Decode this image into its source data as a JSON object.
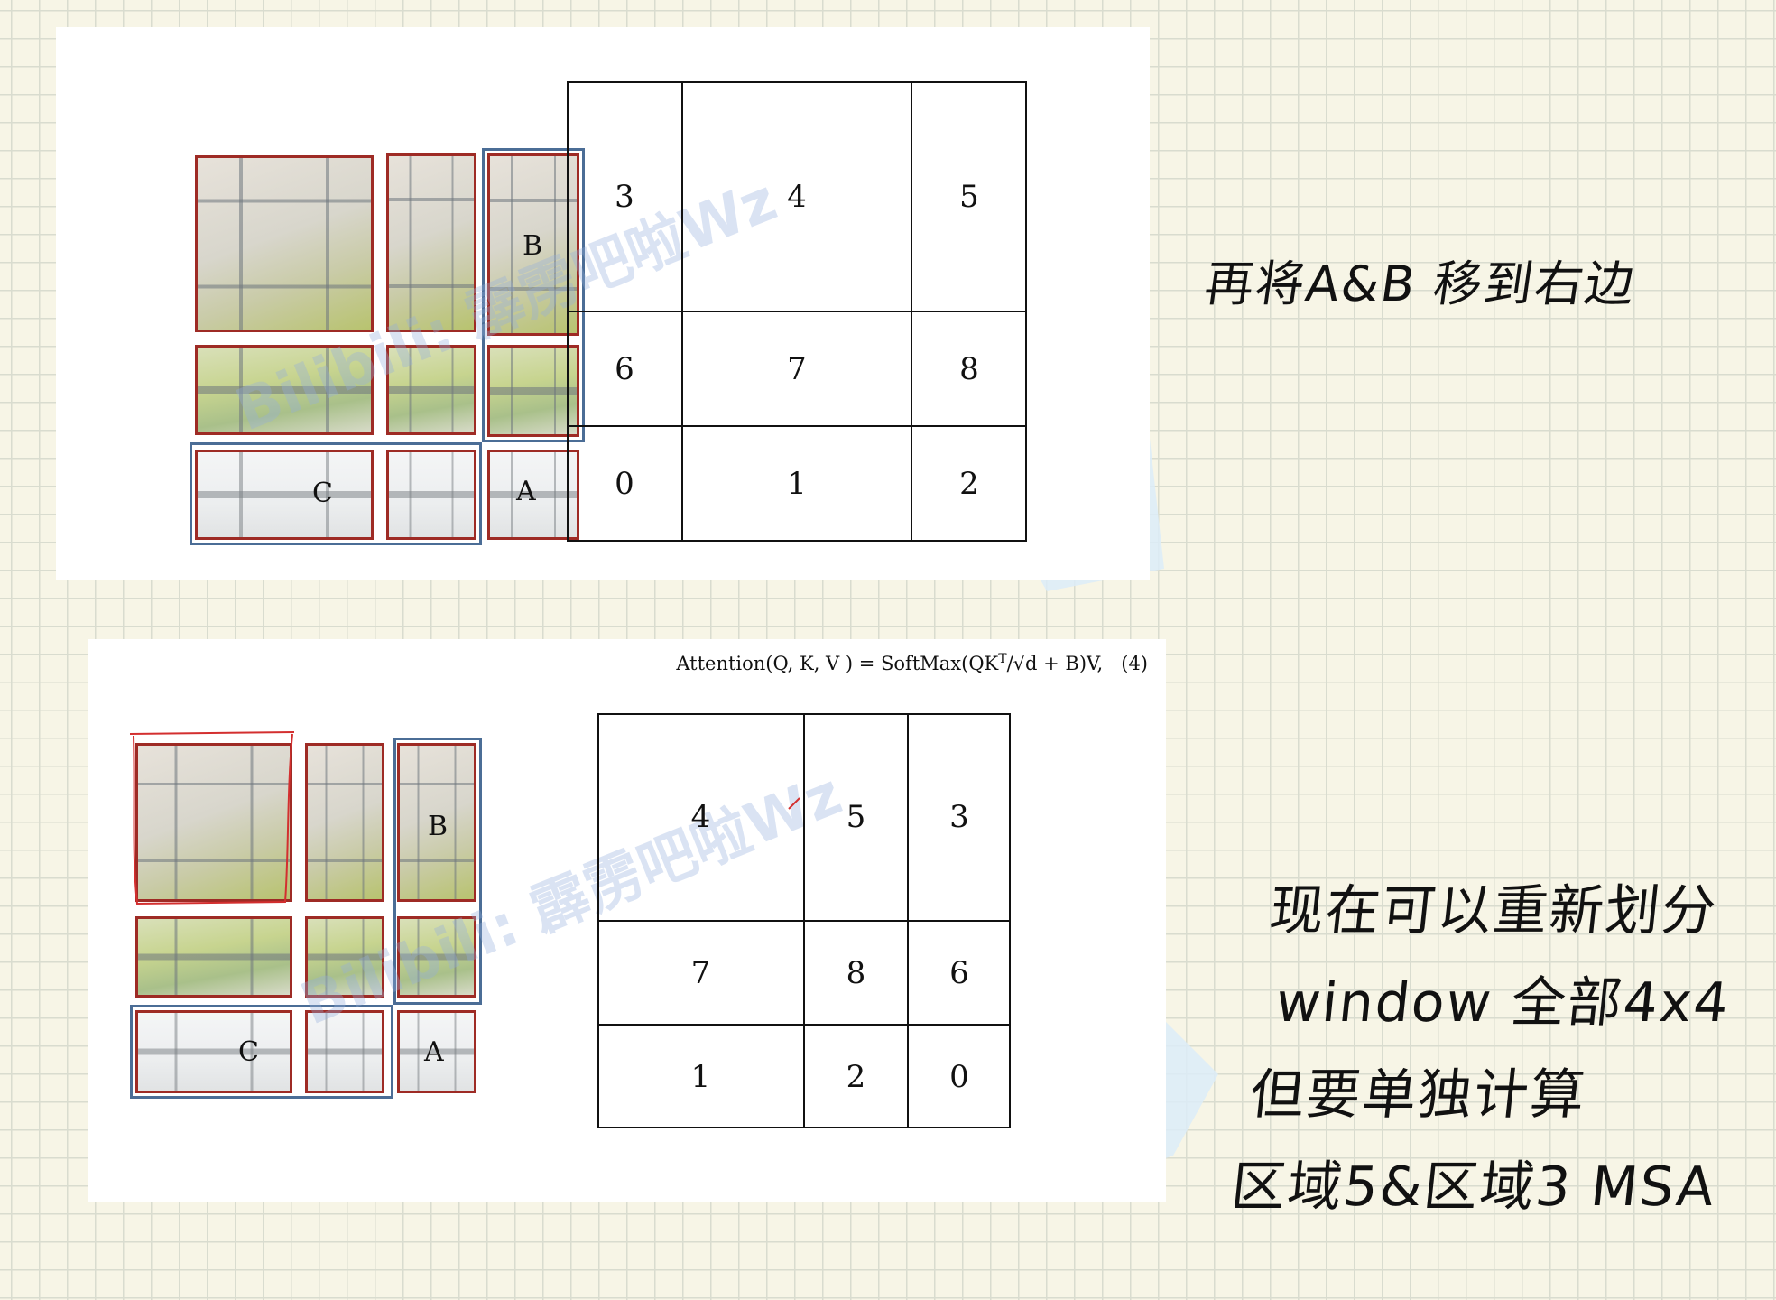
{
  "slide_top": {
    "labels": {
      "B": "B",
      "C": "C",
      "A": "A"
    },
    "watermark": "Bilibili: 霹雳吧啦Wz",
    "grid": [
      [
        "3",
        "4",
        "5"
      ],
      [
        "6",
        "7",
        "8"
      ],
      [
        "0",
        "1",
        "2"
      ]
    ]
  },
  "slide_bottom": {
    "formula": {
      "lhs": "Attention(Q, K, V ) = SoftMax(QK",
      "sup": "T",
      "mid": "/√d + B)V,",
      "number": "(4)"
    },
    "labels": {
      "B": "B",
      "C": "C",
      "A": "A"
    },
    "watermark": "Bilibili: 霹雳吧啦Wz",
    "grid": [
      [
        "4",
        "5",
        "3"
      ],
      [
        "7",
        "8",
        "6"
      ],
      [
        "1",
        "2",
        "0"
      ]
    ]
  },
  "notes": {
    "top": "再将A&B 移到右边",
    "bottom": [
      "现在可以重新划分",
      "window 全部4x4",
      "但要单独计算",
      "区域5&区域3 MSA"
    ]
  },
  "colors": {
    "tile_border": "#9e2b25",
    "group_border": "#4b6d96",
    "annotation": "#d32f2f"
  }
}
